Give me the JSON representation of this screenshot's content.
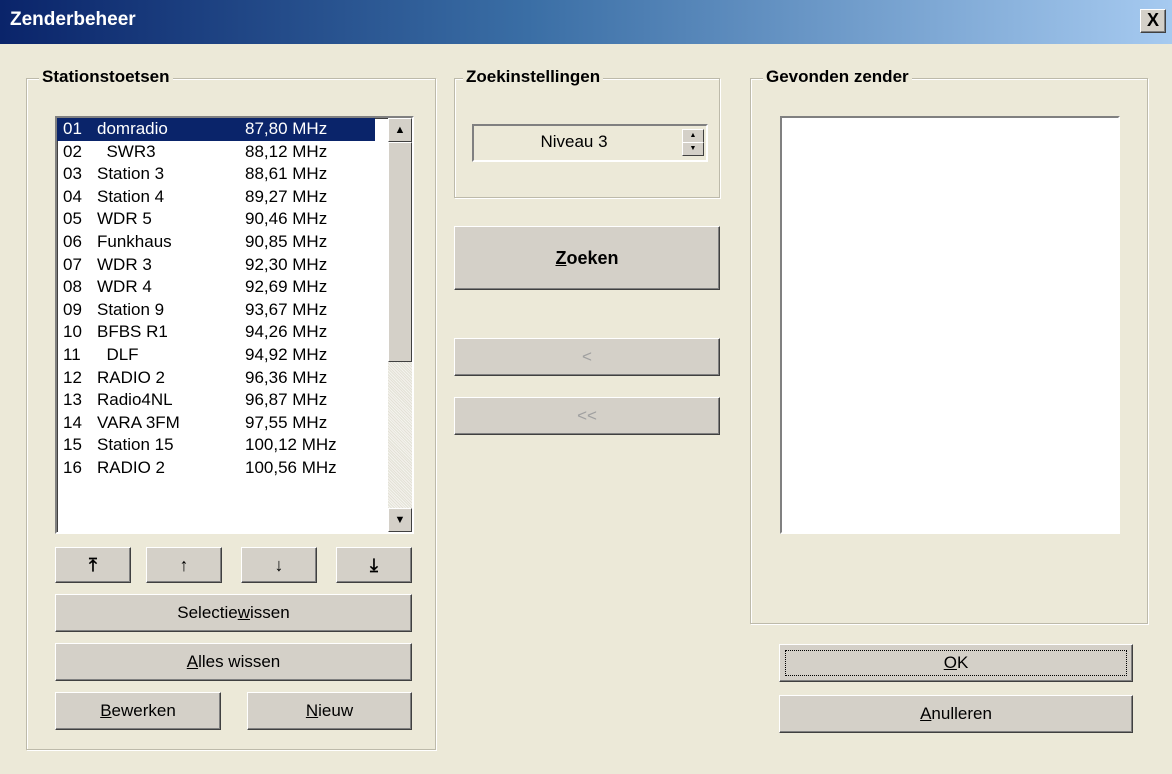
{
  "window": {
    "title": "Zenderbeheer",
    "close_label": "X"
  },
  "presets": {
    "legend": "Stationstoetsen",
    "stations": [
      {
        "num": "01",
        "name": "domradio",
        "freq": "87,80 MHz",
        "selected": true
      },
      {
        "num": "02",
        "name": "  SWR3",
        "freq": "88,12 MHz"
      },
      {
        "num": "03",
        "name": "Station 3",
        "freq": "88,61 MHz"
      },
      {
        "num": "04",
        "name": "Station 4",
        "freq": "89,27 MHz"
      },
      {
        "num": "05",
        "name": "WDR 5",
        "freq": "90,46 MHz"
      },
      {
        "num": "06",
        "name": "Funkhaus",
        "freq": "90,85 MHz"
      },
      {
        "num": "07",
        "name": "WDR 3",
        "freq": "92,30 MHz"
      },
      {
        "num": "08",
        "name": "WDR 4",
        "freq": "92,69 MHz"
      },
      {
        "num": "09",
        "name": "Station 9",
        "freq": "93,67 MHz"
      },
      {
        "num": "10",
        "name": "BFBS R1",
        "freq": "94,26 MHz"
      },
      {
        "num": "11",
        "name": "  DLF",
        "freq": "94,92 MHz"
      },
      {
        "num": "12",
        "name": "RADIO 2",
        "freq": "96,36 MHz"
      },
      {
        "num": "13",
        "name": "Radio4NL",
        "freq": "96,87 MHz"
      },
      {
        "num": "14",
        "name": "VARA 3FM",
        "freq": "97,55 MHz"
      },
      {
        "num": "15",
        "name": "Station 15",
        "freq": "100,12 MHz"
      },
      {
        "num": "16",
        "name": "RADIO 2",
        "freq": "100,56 MHz"
      }
    ],
    "move_buttons": {
      "top": "⤒",
      "up": "↑",
      "down": "↓",
      "bottom": "⤓"
    },
    "clear_selection": {
      "pre": "Selectie ",
      "u": "w",
      "post": "issen"
    },
    "clear_all": {
      "pre": "",
      "u": "A",
      "post": "lles wissen"
    },
    "edit": {
      "pre": "",
      "u": "B",
      "post": "ewerken"
    },
    "new": {
      "pre": "",
      "u": "N",
      "post": "ieuw"
    }
  },
  "search": {
    "legend": "Zoekinstellingen",
    "level": "Niveau 3",
    "search_button": {
      "pre": "",
      "u": "Z",
      "post": "oeken"
    },
    "add_one": "<",
    "add_all": "<<"
  },
  "found": {
    "legend": "Gevonden zender",
    "ok": {
      "pre": "",
      "u": "O",
      "post": "K"
    },
    "cancel": {
      "pre": "",
      "u": "A",
      "post": "nulleren"
    }
  }
}
